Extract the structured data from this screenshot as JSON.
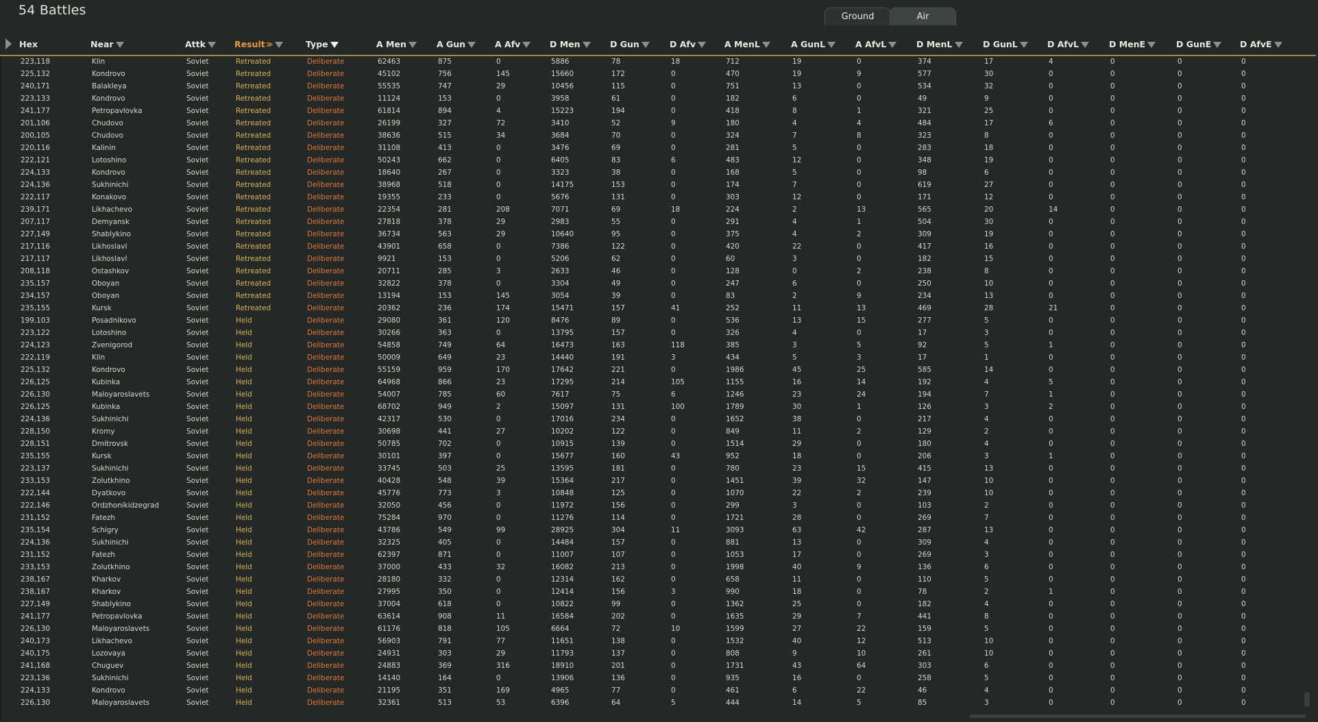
{
  "window": {
    "title": "54 Battles"
  },
  "tabs": [
    {
      "label": "Ground"
    },
    {
      "label": "Air"
    }
  ],
  "columns": [
    "Hex",
    "Near",
    "Attk",
    "Result",
    "Type",
    "A Men",
    "A Gun",
    "A Afv",
    "D Men",
    "D Gun",
    "D Afv",
    "A MenL",
    "A GunL",
    "A AfvL",
    "D MenL",
    "D GunL",
    "D AfvL",
    "D MenE",
    "D GunE",
    "D AfvE"
  ],
  "sort": {
    "column": "Result",
    "indicator": "≫"
  },
  "rows": [
    [
      "223,118",
      "Klin",
      "Soviet",
      "Retreated",
      "Deliberate",
      "62463",
      "875",
      "0",
      "5886",
      "78",
      "18",
      "712",
      "19",
      "0",
      "374",
      "17",
      "4",
      "0",
      "0",
      "0"
    ],
    [
      "225,132",
      "Kondrovo",
      "Soviet",
      "Retreated",
      "Deliberate",
      "45102",
      "756",
      "145",
      "15660",
      "172",
      "0",
      "470",
      "19",
      "9",
      "577",
      "30",
      "0",
      "0",
      "0",
      "0"
    ],
    [
      "240,171",
      "Balakleya",
      "Soviet",
      "Retreated",
      "Deliberate",
      "55535",
      "747",
      "29",
      "10456",
      "115",
      "0",
      "751",
      "13",
      "0",
      "534",
      "32",
      "0",
      "0",
      "0",
      "0"
    ],
    [
      "223,133",
      "Kondrovo",
      "Soviet",
      "Retreated",
      "Deliberate",
      "11124",
      "153",
      "0",
      "3958",
      "61",
      "0",
      "182",
      "6",
      "0",
      "49",
      "9",
      "0",
      "0",
      "0",
      "0"
    ],
    [
      "241,177",
      "Petropavlovka",
      "Soviet",
      "Retreated",
      "Deliberate",
      "61814",
      "894",
      "4",
      "15223",
      "194",
      "0",
      "418",
      "8",
      "1",
      "321",
      "25",
      "0",
      "0",
      "0",
      "0"
    ],
    [
      "201,106",
      "Chudovo",
      "Soviet",
      "Retreated",
      "Deliberate",
      "26199",
      "327",
      "72",
      "3410",
      "52",
      "9",
      "180",
      "4",
      "4",
      "484",
      "17",
      "6",
      "0",
      "0",
      "0"
    ],
    [
      "200,105",
      "Chudovo",
      "Soviet",
      "Retreated",
      "Deliberate",
      "38636",
      "515",
      "34",
      "3684",
      "70",
      "0",
      "324",
      "7",
      "8",
      "323",
      "8",
      "0",
      "0",
      "0",
      "0"
    ],
    [
      "220,116",
      "Kalinin",
      "Soviet",
      "Retreated",
      "Deliberate",
      "31108",
      "413",
      "0",
      "3476",
      "69",
      "0",
      "281",
      "5",
      "0",
      "283",
      "18",
      "0",
      "0",
      "0",
      "0"
    ],
    [
      "222,121",
      "Lotoshino",
      "Soviet",
      "Retreated",
      "Deliberate",
      "50243",
      "662",
      "0",
      "6405",
      "83",
      "6",
      "483",
      "12",
      "0",
      "348",
      "19",
      "0",
      "0",
      "0",
      "0"
    ],
    [
      "224,133",
      "Kondrovo",
      "Soviet",
      "Retreated",
      "Deliberate",
      "18640",
      "267",
      "0",
      "3323",
      "38",
      "0",
      "168",
      "5",
      "0",
      "98",
      "6",
      "0",
      "0",
      "0",
      "0"
    ],
    [
      "224,136",
      "Sukhinichi",
      "Soviet",
      "Retreated",
      "Deliberate",
      "38968",
      "518",
      "0",
      "14175",
      "153",
      "0",
      "174",
      "7",
      "0",
      "619",
      "27",
      "0",
      "0",
      "0",
      "0"
    ],
    [
      "222,117",
      "Konakovo",
      "Soviet",
      "Retreated",
      "Deliberate",
      "19355",
      "233",
      "0",
      "5676",
      "131",
      "0",
      "303",
      "12",
      "0",
      "171",
      "12",
      "0",
      "0",
      "0",
      "0"
    ],
    [
      "239,171",
      "Likhachevo",
      "Soviet",
      "Retreated",
      "Deliberate",
      "22354",
      "281",
      "208",
      "7071",
      "69",
      "18",
      "224",
      "2",
      "13",
      "565",
      "20",
      "14",
      "0",
      "0",
      "0"
    ],
    [
      "207,117",
      "Demyansk",
      "Soviet",
      "Retreated",
      "Deliberate",
      "27818",
      "378",
      "29",
      "2983",
      "55",
      "0",
      "291",
      "4",
      "1",
      "504",
      "30",
      "0",
      "0",
      "0",
      "0"
    ],
    [
      "227,149",
      "Shablykino",
      "Soviet",
      "Retreated",
      "Deliberate",
      "36734",
      "563",
      "29",
      "10640",
      "95",
      "0",
      "375",
      "4",
      "2",
      "309",
      "19",
      "0",
      "0",
      "0",
      "0"
    ],
    [
      "217,116",
      "Likhoslavl",
      "Soviet",
      "Retreated",
      "Deliberate",
      "43901",
      "658",
      "0",
      "7386",
      "122",
      "0",
      "420",
      "22",
      "0",
      "417",
      "16",
      "0",
      "0",
      "0",
      "0"
    ],
    [
      "217,117",
      "Likhoslavl",
      "Soviet",
      "Retreated",
      "Deliberate",
      "9921",
      "153",
      "0",
      "5206",
      "62",
      "0",
      "60",
      "3",
      "0",
      "182",
      "15",
      "0",
      "0",
      "0",
      "0"
    ],
    [
      "208,118",
      "Ostashkov",
      "Soviet",
      "Retreated",
      "Deliberate",
      "20711",
      "285",
      "3",
      "2633",
      "46",
      "0",
      "128",
      "0",
      "2",
      "238",
      "8",
      "0",
      "0",
      "0",
      "0"
    ],
    [
      "235,157",
      "Oboyan",
      "Soviet",
      "Retreated",
      "Deliberate",
      "32822",
      "378",
      "0",
      "3304",
      "49",
      "0",
      "247",
      "6",
      "0",
      "250",
      "10",
      "0",
      "0",
      "0",
      "0"
    ],
    [
      "234,157",
      "Oboyan",
      "Soviet",
      "Retreated",
      "Deliberate",
      "13194",
      "153",
      "145",
      "3054",
      "39",
      "0",
      "83",
      "2",
      "9",
      "234",
      "13",
      "0",
      "0",
      "0",
      "0"
    ],
    [
      "235,155",
      "Kursk",
      "Soviet",
      "Retreated",
      "Deliberate",
      "20362",
      "236",
      "174",
      "15471",
      "157",
      "41",
      "252",
      "11",
      "13",
      "469",
      "28",
      "21",
      "0",
      "0",
      "0"
    ],
    [
      "199,103",
      "Posadnikovo",
      "Soviet",
      "Held",
      "Deliberate",
      "29080",
      "361",
      "120",
      "8476",
      "89",
      "0",
      "536",
      "13",
      "15",
      "277",
      "5",
      "0",
      "0",
      "0",
      "0"
    ],
    [
      "223,122",
      "Lotoshino",
      "Soviet",
      "Held",
      "Deliberate",
      "30266",
      "363",
      "0",
      "13795",
      "157",
      "0",
      "326",
      "4",
      "0",
      "17",
      "3",
      "0",
      "0",
      "0",
      "0"
    ],
    [
      "224,123",
      "Zvenigorod",
      "Soviet",
      "Held",
      "Deliberate",
      "54858",
      "749",
      "64",
      "16473",
      "163",
      "118",
      "385",
      "3",
      "5",
      "92",
      "5",
      "1",
      "0",
      "0",
      "0"
    ],
    [
      "222,119",
      "Klin",
      "Soviet",
      "Held",
      "Deliberate",
      "50009",
      "649",
      "23",
      "14440",
      "191",
      "3",
      "434",
      "5",
      "3",
      "17",
      "1",
      "0",
      "0",
      "0",
      "0"
    ],
    [
      "225,132",
      "Kondrovo",
      "Soviet",
      "Held",
      "Deliberate",
      "55159",
      "959",
      "170",
      "17642",
      "221",
      "0",
      "1986",
      "45",
      "25",
      "585",
      "14",
      "0",
      "0",
      "0",
      "0"
    ],
    [
      "226,125",
      "Kubinka",
      "Soviet",
      "Held",
      "Deliberate",
      "64968",
      "866",
      "23",
      "17295",
      "214",
      "105",
      "1155",
      "16",
      "14",
      "192",
      "4",
      "5",
      "0",
      "0",
      "0"
    ],
    [
      "226,130",
      "Maloyaroslavets",
      "Soviet",
      "Held",
      "Deliberate",
      "54007",
      "785",
      "60",
      "7617",
      "75",
      "6",
      "1246",
      "23",
      "24",
      "194",
      "7",
      "1",
      "0",
      "0",
      "0"
    ],
    [
      "226,125",
      "Kubinka",
      "Soviet",
      "Held",
      "Deliberate",
      "68702",
      "949",
      "2",
      "15097",
      "131",
      "100",
      "1789",
      "30",
      "1",
      "126",
      "3",
      "2",
      "0",
      "0",
      "0"
    ],
    [
      "224,136",
      "Sukhinichi",
      "Soviet",
      "Held",
      "Deliberate",
      "42317",
      "530",
      "0",
      "17016",
      "234",
      "0",
      "1652",
      "38",
      "0",
      "217",
      "4",
      "0",
      "0",
      "0",
      "0"
    ],
    [
      "228,150",
      "Kromy",
      "Soviet",
      "Held",
      "Deliberate",
      "30698",
      "441",
      "27",
      "10202",
      "122",
      "0",
      "849",
      "11",
      "2",
      "129",
      "2",
      "0",
      "0",
      "0",
      "0"
    ],
    [
      "228,151",
      "Dmitrovsk",
      "Soviet",
      "Held",
      "Deliberate",
      "50785",
      "702",
      "0",
      "10915",
      "139",
      "0",
      "1514",
      "29",
      "0",
      "180",
      "4",
      "0",
      "0",
      "0",
      "0"
    ],
    [
      "235,155",
      "Kursk",
      "Soviet",
      "Held",
      "Deliberate",
      "30101",
      "397",
      "0",
      "15677",
      "160",
      "43",
      "952",
      "18",
      "0",
      "206",
      "3",
      "1",
      "0",
      "0",
      "0"
    ],
    [
      "223,137",
      "Sukhinichi",
      "Soviet",
      "Held",
      "Deliberate",
      "33745",
      "503",
      "25",
      "13595",
      "181",
      "0",
      "780",
      "23",
      "15",
      "415",
      "13",
      "0",
      "0",
      "0",
      "0"
    ],
    [
      "233,153",
      "Zolutkhino",
      "Soviet",
      "Held",
      "Deliberate",
      "40428",
      "548",
      "39",
      "15364",
      "217",
      "0",
      "1451",
      "39",
      "32",
      "147",
      "10",
      "0",
      "0",
      "0",
      "0"
    ],
    [
      "222,144",
      "Dyatkovo",
      "Soviet",
      "Held",
      "Deliberate",
      "45776",
      "773",
      "3",
      "10848",
      "125",
      "0",
      "1070",
      "22",
      "2",
      "239",
      "10",
      "0",
      "0",
      "0",
      "0"
    ],
    [
      "222,146",
      "Ordzhonikidzegrad",
      "Soviet",
      "Held",
      "Deliberate",
      "32050",
      "456",
      "0",
      "11972",
      "156",
      "0",
      "299",
      "3",
      "0",
      "103",
      "2",
      "0",
      "0",
      "0",
      "0"
    ],
    [
      "231,152",
      "Fatezh",
      "Soviet",
      "Held",
      "Deliberate",
      "75284",
      "970",
      "0",
      "11276",
      "114",
      "0",
      "1721",
      "28",
      "0",
      "269",
      "7",
      "0",
      "0",
      "0",
      "0"
    ],
    [
      "235,154",
      "Schigry",
      "Soviet",
      "Held",
      "Deliberate",
      "43786",
      "549",
      "99",
      "28925",
      "304",
      "11",
      "3093",
      "63",
      "42",
      "287",
      "13",
      "0",
      "0",
      "0",
      "0"
    ],
    [
      "224,136",
      "Sukhinichi",
      "Soviet",
      "Held",
      "Deliberate",
      "32325",
      "405",
      "0",
      "14484",
      "157",
      "0",
      "881",
      "13",
      "0",
      "309",
      "4",
      "0",
      "0",
      "0",
      "0"
    ],
    [
      "231,152",
      "Fatezh",
      "Soviet",
      "Held",
      "Deliberate",
      "62397",
      "871",
      "0",
      "11007",
      "107",
      "0",
      "1053",
      "17",
      "0",
      "269",
      "3",
      "0",
      "0",
      "0",
      "0"
    ],
    [
      "233,153",
      "Zolutkhino",
      "Soviet",
      "Held",
      "Deliberate",
      "37000",
      "433",
      "32",
      "16082",
      "213",
      "0",
      "1998",
      "40",
      "9",
      "136",
      "6",
      "0",
      "0",
      "0",
      "0"
    ],
    [
      "238,167",
      "Kharkov",
      "Soviet",
      "Held",
      "Deliberate",
      "28180",
      "332",
      "0",
      "12314",
      "162",
      "0",
      "658",
      "11",
      "0",
      "110",
      "5",
      "0",
      "0",
      "0",
      "0"
    ],
    [
      "238,167",
      "Kharkov",
      "Soviet",
      "Held",
      "Deliberate",
      "27995",
      "350",
      "0",
      "12414",
      "156",
      "3",
      "990",
      "18",
      "0",
      "78",
      "2",
      "1",
      "0",
      "0",
      "0"
    ],
    [
      "227,149",
      "Shablykino",
      "Soviet",
      "Held",
      "Deliberate",
      "37004",
      "618",
      "0",
      "10822",
      "99",
      "0",
      "1362",
      "25",
      "0",
      "182",
      "4",
      "0",
      "0",
      "0",
      "0"
    ],
    [
      "241,177",
      "Petropavlovka",
      "Soviet",
      "Held",
      "Deliberate",
      "63614",
      "908",
      "11",
      "16584",
      "202",
      "0",
      "1635",
      "29",
      "7",
      "441",
      "8",
      "0",
      "0",
      "0",
      "0"
    ],
    [
      "226,130",
      "Maloyaroslavets",
      "Soviet",
      "Held",
      "Deliberate",
      "61176",
      "818",
      "105",
      "6664",
      "72",
      "10",
      "1599",
      "27",
      "22",
      "159",
      "5",
      "0",
      "0",
      "0",
      "0"
    ],
    [
      "240,173",
      "Likhachevo",
      "Soviet",
      "Held",
      "Deliberate",
      "56903",
      "791",
      "77",
      "11651",
      "138",
      "0",
      "1532",
      "40",
      "12",
      "513",
      "10",
      "0",
      "0",
      "0",
      "0"
    ],
    [
      "240,175",
      "Lozovaya",
      "Soviet",
      "Held",
      "Deliberate",
      "24931",
      "303",
      "29",
      "11793",
      "137",
      "0",
      "808",
      "9",
      "10",
      "261",
      "10",
      "0",
      "0",
      "0",
      "0"
    ],
    [
      "241,168",
      "Chuguev",
      "Soviet",
      "Held",
      "Deliberate",
      "24883",
      "369",
      "316",
      "18910",
      "201",
      "0",
      "1731",
      "43",
      "64",
      "303",
      "6",
      "0",
      "0",
      "0",
      "0"
    ],
    [
      "223,136",
      "Sukhinichi",
      "Soviet",
      "Held",
      "Deliberate",
      "14140",
      "164",
      "0",
      "13906",
      "136",
      "0",
      "935",
      "16",
      "0",
      "258",
      "5",
      "0",
      "0",
      "0",
      "0"
    ],
    [
      "224,133",
      "Kondrovo",
      "Soviet",
      "Held",
      "Deliberate",
      "21195",
      "351",
      "169",
      "4965",
      "77",
      "0",
      "461",
      "6",
      "22",
      "46",
      "4",
      "0",
      "0",
      "0",
      "0"
    ],
    [
      "226,130",
      "Maloyaroslavets",
      "Soviet",
      "Held",
      "Deliberate",
      "32361",
      "513",
      "53",
      "6396",
      "64",
      "5",
      "444",
      "14",
      "5",
      "85",
      "3",
      "0",
      "0",
      "0",
      "0"
    ]
  ]
}
